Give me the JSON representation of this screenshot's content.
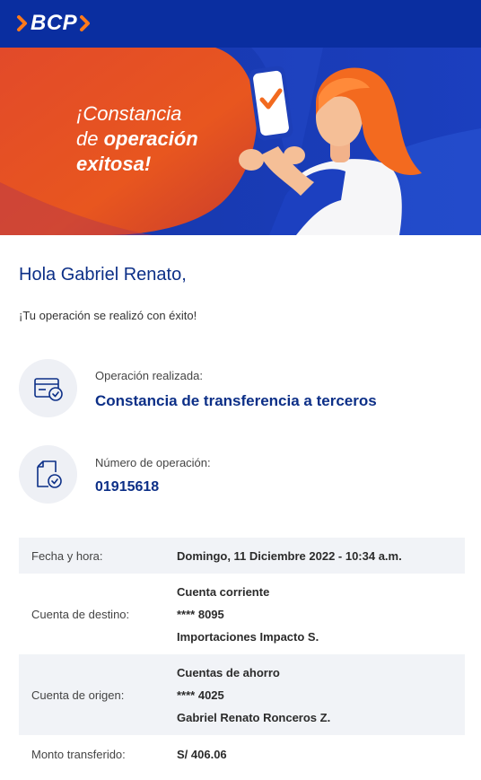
{
  "brand": {
    "logo_text": "BCP",
    "primary_color": "#0a2ea0",
    "accent_color": "#ff6b1a"
  },
  "banner": {
    "line1": "¡Constancia",
    "line2_prefix": "de ",
    "line2_bold": "operación",
    "line3": "exitosa!"
  },
  "greeting": "Hola Gabriel Renato,",
  "subtext": "¡Tu operación se realizó con éxito!",
  "operation": {
    "label": "Operación realizada:",
    "value": "Constancia de transferencia a terceros",
    "icon": "card-check-icon"
  },
  "operation_number": {
    "label": "Número de operación:",
    "value": "01915618",
    "icon": "document-check-icon"
  },
  "details": [
    {
      "label": "Fecha y hora:",
      "lines": [
        "Domingo, 11 Diciembre 2022 - 10:34 a.m."
      ]
    },
    {
      "label": "Cuenta de destino:",
      "lines": [
        "Cuenta corriente",
        "**** 8095",
        "Importaciones Impacto S."
      ]
    },
    {
      "label": "Cuenta de origen:",
      "lines": [
        "Cuentas de ahorro",
        "**** 4025",
        "Gabriel Renato Ronceros Z."
      ]
    },
    {
      "label": "Monto transferido:",
      "lines": [
        "S/ 406.06"
      ]
    }
  ]
}
